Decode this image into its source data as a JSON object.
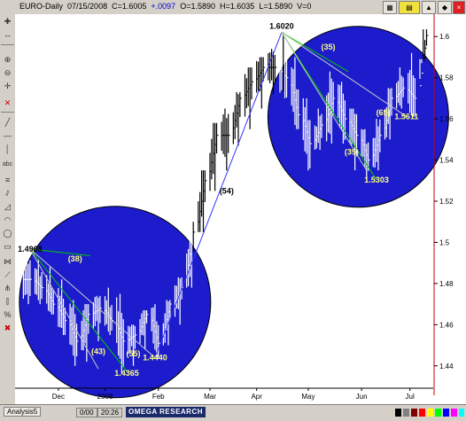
{
  "window": {
    "symbol": "EURO-Daily",
    "date": "07/15/2008",
    "close": "C=1.6005",
    "change": "+.0097",
    "open": "O=1.5890",
    "high": "H=1.6035",
    "low": "L=1.5890",
    "volume": "V=0"
  },
  "toolbar_icons": [
    "plus-icon",
    "move-icon",
    "zoom-in-icon",
    "zoom-out-icon",
    "crosshair-icon",
    "trendline-icon",
    "horizontal-line-icon",
    "vertical-line-icon",
    "text-icon",
    "fibonacci-icon",
    "channel-icon",
    "gann-icon",
    "arc-icon",
    "ellipse-icon",
    "rectangle-icon",
    "cycle-icon",
    "speed-line-icon",
    "pitchfork-icon",
    "andrews-icon",
    "percent-icon",
    "delete-icon"
  ],
  "colors": {
    "background": "#ffffff",
    "bars": "#000000",
    "circle_fill": "#1c1ccc",
    "circle_bars": "#ffffff",
    "annotation_lines": "#00cc00",
    "price_axis_line": "#cc0000",
    "connector_line": "#3333ff"
  },
  "status": {
    "tab": "Analysis5",
    "field1": "0/00",
    "field2": "20:26",
    "logo": "OMEGA RESEARCH"
  },
  "chart_data": {
    "type": "bar",
    "title": "EURO-Daily",
    "x_ticks": [
      "Dec",
      "2008",
      "Feb",
      "Mar",
      "Apr",
      "May",
      "Jun",
      "Jul"
    ],
    "y_ticks": [
      "1.6",
      "1.58",
      "1.56",
      "1.54",
      "1.52",
      "1.5",
      "1.48",
      "1.46",
      "1.44"
    ],
    "ylim": [
      1.43,
      1.61
    ],
    "annotations": [
      {
        "label": "1.4968",
        "x": "Nov 23",
        "y": 1.4968,
        "kind": "price"
      },
      {
        "label": "(38)",
        "x": "Dec 20",
        "y": 1.492,
        "kind": "count"
      },
      {
        "label": "(43)",
        "x": "Jan 3",
        "y": 1.447,
        "kind": "count"
      },
      {
        "label": "(55)",
        "x": "Jan 24",
        "y": 1.446,
        "kind": "count"
      },
      {
        "label": "1.4365",
        "x": "Jan 20",
        "y": 1.4365,
        "kind": "price"
      },
      {
        "label": "1.4440",
        "x": "Feb 6",
        "y": 1.444,
        "kind": "price"
      },
      {
        "label": "(54)",
        "x": "Mar 20",
        "y": 1.525,
        "kind": "count"
      },
      {
        "label": "1.6020",
        "x": "Apr 22",
        "y": 1.602,
        "kind": "price"
      },
      {
        "label": "(35)",
        "x": "May 20",
        "y": 1.595,
        "kind": "count"
      },
      {
        "label": "(65)",
        "x": "Jun 22",
        "y": 1.563,
        "kind": "count"
      },
      {
        "label": "(39)",
        "x": "Jun 3",
        "y": 1.544,
        "kind": "count"
      },
      {
        "label": "1.5303",
        "x": "Jun 18",
        "y": 1.5303,
        "kind": "price"
      },
      {
        "label": "1.5611",
        "x": "Jul 6",
        "y": 1.5611,
        "kind": "price"
      }
    ],
    "regions": [
      {
        "name": "lower-circle",
        "x_center": "Jan 13",
        "y_center": 1.471,
        "label": "bottom formation Dec 2007 - Feb 2008"
      },
      {
        "name": "upper-circle",
        "x_center": "Jun 7",
        "y_center": 1.561,
        "label": "top formation Apr - Jul 2008"
      }
    ],
    "series": [
      {
        "name": "",
        "dates": [
          "2007-11-19",
          "2007-11-26",
          "2007-12-03",
          "2007-12-10",
          "2007-12-17",
          "2007-12-24",
          "2007-12-31",
          "2008-01-07",
          "2008-01-14",
          "2008-01-21",
          "2008-01-28",
          "2008-02-04",
          "2008-02-11",
          "2008-02-18",
          "2008-02-25",
          "2008-03-03",
          "2008-03-10",
          "2008-03-17",
          "2008-03-24",
          "2008-03-31",
          "2008-04-07",
          "2008-04-14",
          "2008-04-21",
          "2008-04-28",
          "2008-05-05",
          "2008-05-12",
          "2008-05-19",
          "2008-05-26",
          "2008-06-02",
          "2008-06-09",
          "2008-06-16",
          "2008-06-23",
          "2008-06-30",
          "2008-07-07",
          "2008-07-14"
        ],
        "high": [
          1.4968,
          1.492,
          1.488,
          1.482,
          1.472,
          1.47,
          1.474,
          1.478,
          1.475,
          1.46,
          1.467,
          1.47,
          1.472,
          1.483,
          1.51,
          1.535,
          1.558,
          1.565,
          1.573,
          1.585,
          1.59,
          1.594,
          1.602,
          1.59,
          1.57,
          1.565,
          1.583,
          1.578,
          1.565,
          1.555,
          1.56,
          1.575,
          1.585,
          1.592,
          1.6035
        ],
        "low": [
          1.47,
          1.47,
          1.465,
          1.455,
          1.44,
          1.442,
          1.452,
          1.455,
          1.4365,
          1.44,
          1.448,
          1.444,
          1.45,
          1.46,
          1.478,
          1.505,
          1.525,
          1.535,
          1.547,
          1.555,
          1.565,
          1.572,
          1.57,
          1.555,
          1.535,
          1.545,
          1.548,
          1.548,
          1.535,
          1.5303,
          1.535,
          1.55,
          1.565,
          1.5611,
          1.589
        ],
        "close": [
          1.482,
          1.478,
          1.47,
          1.462,
          1.452,
          1.465,
          1.468,
          1.462,
          1.452,
          1.455,
          1.465,
          1.451,
          1.47,
          1.478,
          1.505,
          1.53,
          1.552,
          1.552,
          1.57,
          1.578,
          1.585,
          1.585,
          1.58,
          1.562,
          1.548,
          1.557,
          1.57,
          1.56,
          1.552,
          1.54,
          1.552,
          1.57,
          1.575,
          1.57,
          1.6005
        ]
      }
    ]
  }
}
